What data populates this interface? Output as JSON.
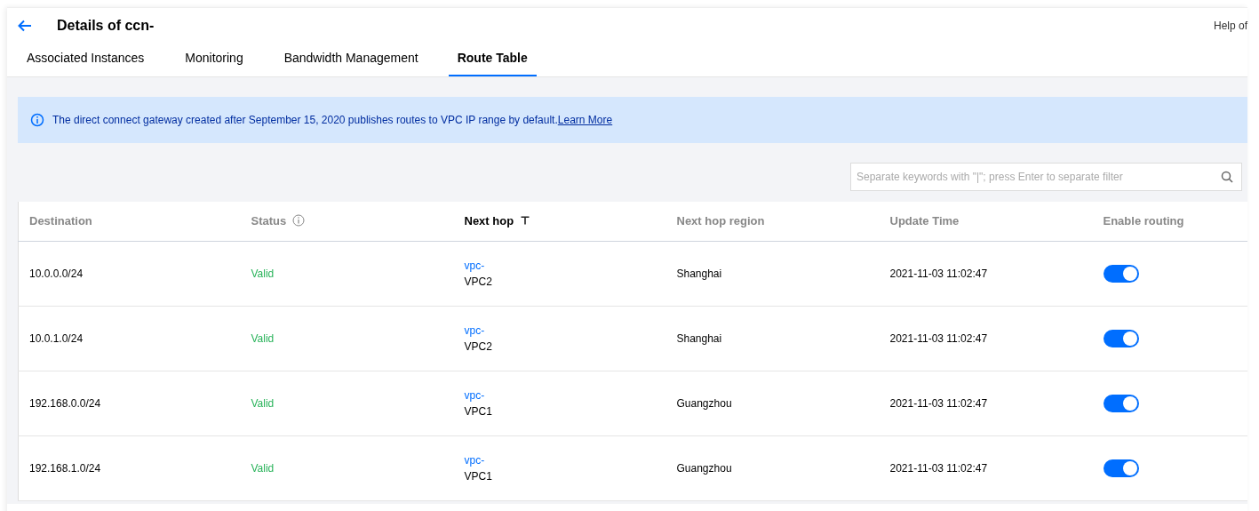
{
  "header": {
    "title": "Details of ccn-",
    "help": "Help of"
  },
  "tabs": [
    {
      "label": "Associated Instances",
      "selected": false
    },
    {
      "label": "Monitoring",
      "selected": false
    },
    {
      "label": "Bandwidth Management",
      "selected": false
    },
    {
      "label": "Route Table",
      "selected": true
    }
  ],
  "notice": {
    "text": "The direct connect gateway created after September 15, 2020 publishes routes to VPC IP range by default.",
    "link": "Learn More"
  },
  "search": {
    "placeholder": "Separate keywords with \"|\"; press Enter to separate filter"
  },
  "table": {
    "columns": [
      {
        "label": "Destination",
        "kind": "plain"
      },
      {
        "label": "Status",
        "kind": "info"
      },
      {
        "label": "Next hop",
        "kind": "filter"
      },
      {
        "label": "Next hop region",
        "kind": "plain"
      },
      {
        "label": "Update Time",
        "kind": "plain"
      },
      {
        "label": "Enable routing",
        "kind": "plain"
      }
    ],
    "rows": [
      {
        "destination": "10.0.0.0/24",
        "status": "Valid",
        "next_hop_id": "vpc-",
        "next_hop_name": "VPC2",
        "region": "Shanghai",
        "update_time": "2021-11-03 11:02:47",
        "routing_enabled": true
      },
      {
        "destination": "10.0.1.0/24",
        "status": "Valid",
        "next_hop_id": "vpc-",
        "next_hop_name": "VPC2",
        "region": "Shanghai",
        "update_time": "2021-11-03 11:02:47",
        "routing_enabled": true
      },
      {
        "destination": "192.168.0.0/24",
        "status": "Valid",
        "next_hop_id": "vpc-",
        "next_hop_name": "VPC1",
        "region": "Guangzhou",
        "update_time": "2021-11-03 11:02:47",
        "routing_enabled": true
      },
      {
        "destination": "192.168.1.0/24",
        "status": "Valid",
        "next_hop_id": "vpc-",
        "next_hop_name": "VPC1",
        "region": "Guangzhou",
        "update_time": "2021-11-03 11:02:47",
        "routing_enabled": true
      }
    ]
  }
}
